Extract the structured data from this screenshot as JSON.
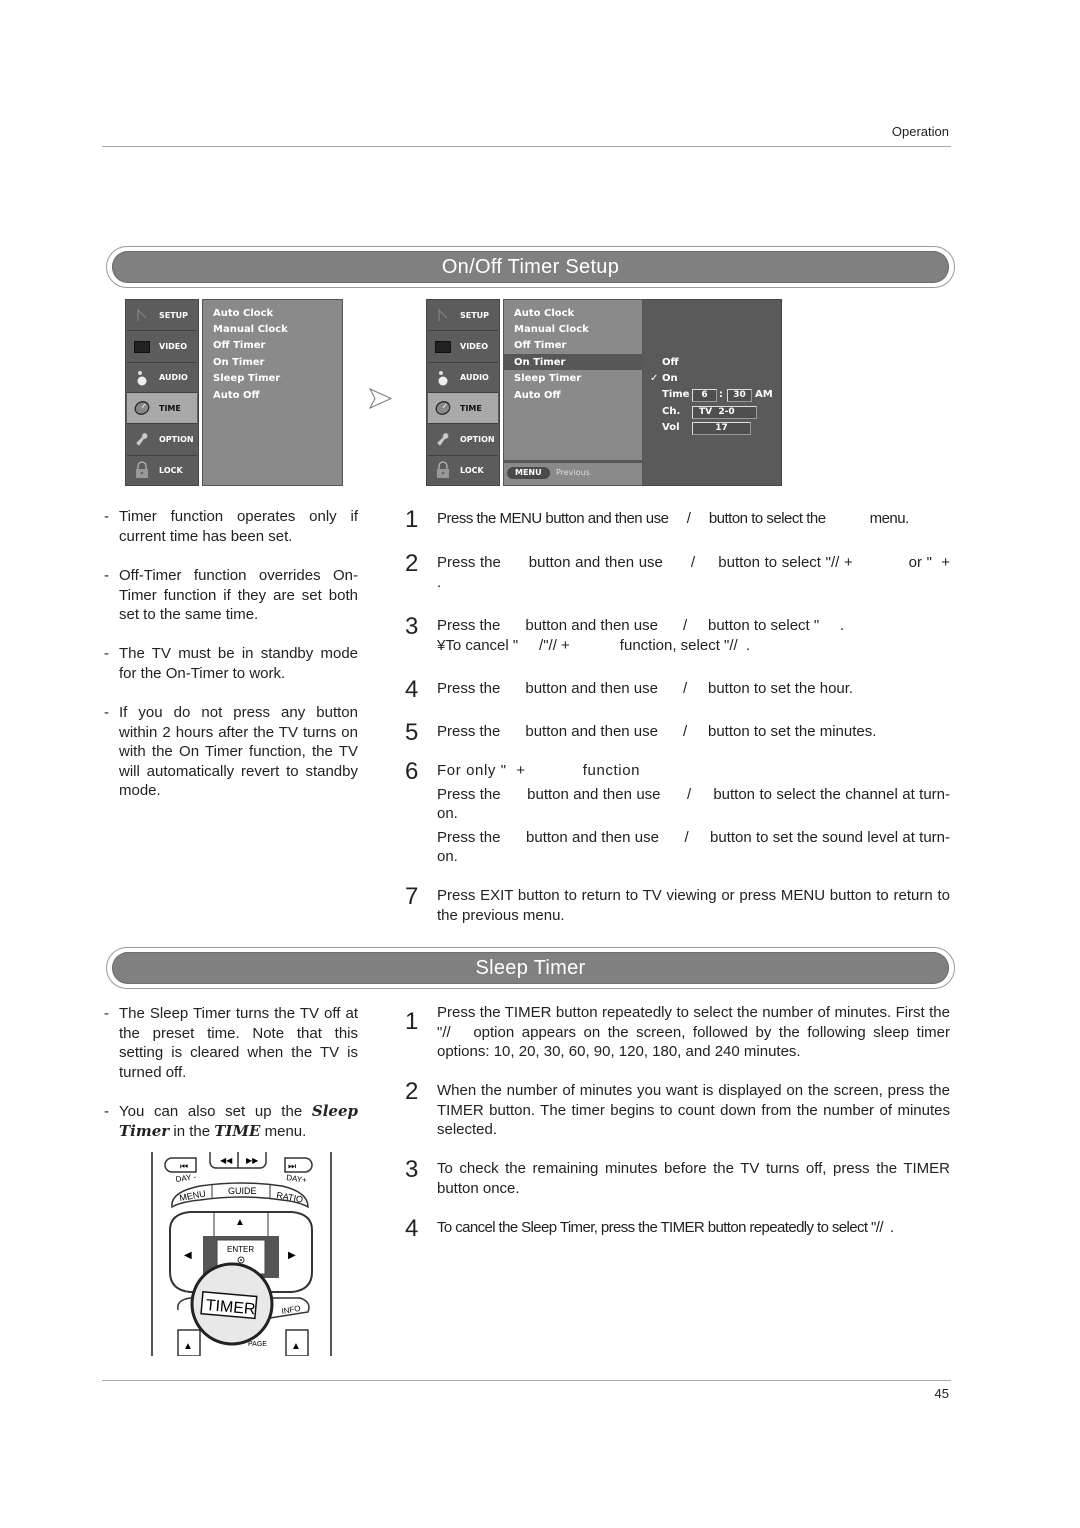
{
  "header": {
    "section": "Operation"
  },
  "sections": {
    "on_off_timer": {
      "title": "On/Off Timer Setup"
    },
    "sleep_timer": {
      "title": "Sleep Timer"
    }
  },
  "osd_left": {
    "tabs": [
      {
        "label": "SETUP",
        "icon": "antenna-icon"
      },
      {
        "label": "VIDEO",
        "icon": "screen-icon"
      },
      {
        "label": "AUDIO",
        "icon": "speaker-icon"
      },
      {
        "label": "TIME",
        "icon": "clock-icon",
        "active": true
      },
      {
        "label": "OPTION",
        "icon": "wrench-icon"
      },
      {
        "label": "LOCK",
        "icon": "padlock-icon"
      }
    ],
    "menu_items": [
      "Auto Clock",
      "Manual Clock",
      "Off Timer",
      "On Timer",
      "Sleep Timer",
      "Auto Off"
    ]
  },
  "osd_arrow": {
    "icon": "next-arrow-icon"
  },
  "osd_right": {
    "tabs": [
      {
        "label": "SETUP",
        "icon": "antenna-icon"
      },
      {
        "label": "VIDEO",
        "icon": "screen-icon"
      },
      {
        "label": "AUDIO",
        "icon": "speaker-icon"
      },
      {
        "label": "TIME",
        "icon": "clock-icon",
        "active": true
      },
      {
        "label": "OPTION",
        "icon": "wrench-icon"
      },
      {
        "label": "LOCK",
        "icon": "padlock-icon"
      }
    ],
    "menu_items": [
      "Auto Clock",
      "Manual Clock",
      "Off Timer",
      "On Timer",
      "Sleep Timer",
      "Auto Off"
    ],
    "selected_item": "On Timer",
    "footer": {
      "button": "MENU",
      "label": "Previous"
    },
    "submenu": {
      "options": [
        "Off",
        "On"
      ],
      "checked": "On",
      "check_mark": "✓",
      "time_label": "Time",
      "hour": "6",
      "separator": ":",
      "minute": "30",
      "ampm": "AM",
      "channel_label": "Ch.",
      "channel": "TV  2-0",
      "volume_label": "Vol",
      "volume": "17"
    }
  },
  "on_off_notes": [
    "Timer function operates only if current time has been set.",
    "Off-Timer function overrides On-Timer function if they are set both set to the same time.",
    "The TV must be in standby mode for the On-Timer to work.",
    "If you do not press any button within 2 hours after the TV turns on with the On Timer function, the TV will automatically revert to standby mode."
  ],
  "on_off_steps": [
    {
      "num": "1",
      "text": "Press the MENU button and then use     /     button to select the            menu."
    },
    {
      "num": "2",
      "text": "Press the      button and then use      /     button to select \"// +            or \"  +          ."
    },
    {
      "num": "3",
      "text": "Press the      button and then use      /     button to select \"     .",
      "sub": "¥To cancel \"     /\"// +            function, select \"//  ."
    },
    {
      "num": "4",
      "text": "Press the      button and then use      /     button to set the hour."
    },
    {
      "num": "5",
      "text": "Press the      button and then use      /     button to set the minutes."
    },
    {
      "num": "6",
      "text": "For only \"  +            function",
      "extra": [
        "Press the      button and then use      /     button to select the channel at turn-on.",
        "Press the      button and then use      /     button to set the sound level at turn-on."
      ]
    },
    {
      "num": "7",
      "text": "Press EXIT button to return to TV viewing or press MENU button to return to the previous menu."
    }
  ],
  "sleep_notes": [
    {
      "text": "The Sleep Timer turns the TV off at the preset time. Note that this setting is cleared when the TV is turned off."
    },
    {
      "prefix": "You can also set up the ",
      "em1": "Sleep Timer",
      "mid": " in the ",
      "em2": "TIME",
      "suffix": " menu."
    }
  ],
  "sleep_steps": [
    {
      "num": "1",
      "text": "Press the TIMER button repeatedly to select the number of minutes. First the \"//   option appears on the screen, followed by the following sleep timer options: 10, 20, 30, 60, 90, 120, 180, and 240 minutes."
    },
    {
      "num": "2",
      "text": "When the number of minutes you want is displayed on the screen, press the TIMER button. The timer begins to count down from the number of minutes selected."
    },
    {
      "num": "3",
      "text": "To check the remaining minutes before the TV turns off, press the TIMER button once."
    },
    {
      "num": "4",
      "text": "To cancel the Sleep Timer, press the TIMER button repeatedly to select \"//  ."
    }
  ],
  "remote": {
    "labels": {
      "day_minus": "DAY -",
      "day_plus": "DAY+",
      "menu": "MENU",
      "guide": "GUIDE",
      "ratio": "RATIO",
      "enter": "ENTER",
      "timer": "TIMER",
      "info": "INFO",
      "page": "PAGE"
    }
  },
  "footer": {
    "page_number": "45"
  }
}
